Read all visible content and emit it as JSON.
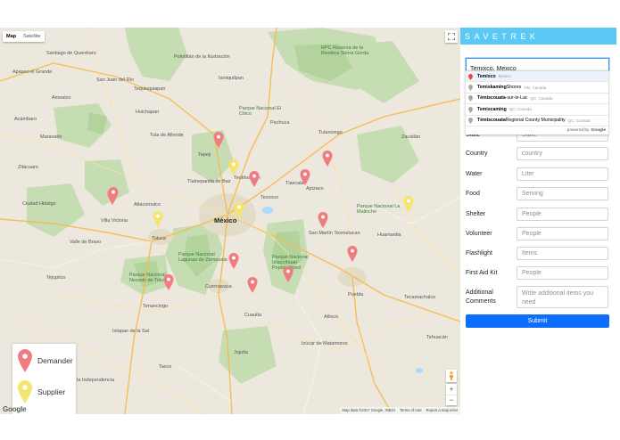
{
  "app": {
    "title": "SAVETREK"
  },
  "map": {
    "type_buttons": [
      {
        "label": "Map",
        "active": true
      },
      {
        "label": "Satellite",
        "active": false
      }
    ],
    "labels": [
      {
        "text": "Santiago de Querétaro",
        "cls": ""
      },
      {
        "text": "Apaseo el Grande",
        "cls": ""
      },
      {
        "text": "San Juan del Río",
        "cls": ""
      },
      {
        "text": "Tequisquiapan",
        "cls": ""
      },
      {
        "text": "Amealco",
        "cls": ""
      },
      {
        "text": "Polotitlán de la Ilustración",
        "cls": ""
      },
      {
        "text": "Huichapan",
        "cls": ""
      },
      {
        "text": "Ixmiquilpan",
        "cls": ""
      },
      {
        "text": "Tula de Allende",
        "cls": ""
      },
      {
        "text": "Pachuca",
        "cls": ""
      },
      {
        "text": "Tulancingo",
        "cls": ""
      },
      {
        "text": "Zacatlán",
        "cls": ""
      },
      {
        "text": "Tepeji",
        "cls": ""
      },
      {
        "text": "Tlalnepantla de Baz",
        "cls": ""
      },
      {
        "text": "Teotihuacán",
        "cls": ""
      },
      {
        "text": "Texcoco",
        "cls": ""
      },
      {
        "text": "México",
        "cls": "city"
      },
      {
        "text": "Atlacomulco",
        "cls": ""
      },
      {
        "text": "Villa Victoria",
        "cls": ""
      },
      {
        "text": "Toluca",
        "cls": ""
      },
      {
        "text": "Cuernavaca",
        "cls": ""
      },
      {
        "text": "Cuautla",
        "cls": ""
      },
      {
        "text": "Puebla",
        "cls": ""
      },
      {
        "text": "Tlaxcala",
        "cls": ""
      },
      {
        "text": "Apizaco",
        "cls": ""
      },
      {
        "text": "Huamantla",
        "cls": ""
      },
      {
        "text": "San Martín Texmelucan",
        "cls": ""
      },
      {
        "text": "Atlixco",
        "cls": ""
      },
      {
        "text": "Tecamachalco",
        "cls": ""
      },
      {
        "text": "Valle de Bravo",
        "cls": ""
      },
      {
        "text": "Tenancingo",
        "cls": ""
      },
      {
        "text": "Ixtapan de la Sal",
        "cls": ""
      },
      {
        "text": "Iguala de la Independencia",
        "cls": ""
      },
      {
        "text": "Taxco",
        "cls": ""
      },
      {
        "text": "Jojutla",
        "cls": ""
      },
      {
        "text": "Izúcar de Matamoros",
        "cls": ""
      },
      {
        "text": "Tehuacán",
        "cls": ""
      },
      {
        "text": "Zitácuaro",
        "cls": ""
      },
      {
        "text": "Tejupilco",
        "cls": ""
      },
      {
        "text": "Acámbaro",
        "cls": ""
      },
      {
        "text": "Maravatío",
        "cls": ""
      },
      {
        "text": "Ciudad Hidalgo",
        "cls": ""
      },
      {
        "text": "Parque Nacional Iztaccíhuatl-Popocatépetl",
        "cls": "green"
      },
      {
        "text": "Parque Nacional Lagunas de Zempoala",
        "cls": "green"
      },
      {
        "text": "Parque Nacional Nevado de Toluca",
        "cls": "green"
      },
      {
        "text": "RPC Reserva de la Biosfera Sierra Gorda",
        "cls": "green"
      },
      {
        "text": "Parque Nacional El Chico",
        "cls": "green"
      },
      {
        "text": "Parque Nacional La Malinche",
        "cls": "green"
      }
    ],
    "markers": [
      {
        "kind": "demander",
        "color": "#f07c82"
      },
      {
        "kind": "demander",
        "color": "#f07c82"
      },
      {
        "kind": "demander",
        "color": "#f07c82"
      },
      {
        "kind": "demander",
        "color": "#f07c82"
      },
      {
        "kind": "demander",
        "color": "#f07c82"
      },
      {
        "kind": "demander",
        "color": "#f07c82"
      },
      {
        "kind": "demander",
        "color": "#f07c82"
      },
      {
        "kind": "demander",
        "color": "#f07c82"
      },
      {
        "kind": "demander",
        "color": "#f07c82"
      },
      {
        "kind": "demander",
        "color": "#f07c82"
      },
      {
        "kind": "demander",
        "color": "#f07c82"
      },
      {
        "kind": "demander",
        "color": "#f07c82"
      },
      {
        "kind": "supplier",
        "color": "#f5e46e"
      },
      {
        "kind": "supplier",
        "color": "#f5e46e"
      },
      {
        "kind": "supplier",
        "color": "#f5e46e"
      },
      {
        "kind": "supplier",
        "color": "#f5e46e"
      }
    ],
    "legend": {
      "demander": {
        "label": "Demander",
        "color": "#f07c82"
      },
      "supplier": {
        "label": "Supplier",
        "color": "#f5e46e"
      }
    },
    "google_logo": "Google",
    "attribution": [
      "Map data ©2017 Google, INEGI",
      "Terms of Use",
      "Report a map error"
    ],
    "zoom_in": "+",
    "zoom_out": "−"
  },
  "search": {
    "value": "Temixco, Mexico",
    "suggestions": [
      {
        "main": "Temixco",
        "rest": "",
        "secondary": "Mexico"
      },
      {
        "main": "Temiskaming",
        "rest": " Shores",
        "secondary": "ON, Canada"
      },
      {
        "main": "Témiscouata",
        "rest": "-sur-le-Lac",
        "secondary": "QC, Canada"
      },
      {
        "main": "Temiscaming",
        "rest": "",
        "secondary": "QC, Canada"
      },
      {
        "main": "Témiscouata",
        "rest": " Regional County Municipality",
        "secondary": "QC, Canada"
      }
    ],
    "powered_by": "powered by",
    "powered_brand": "Google"
  },
  "form": {
    "state": {
      "label": "State",
      "placeholder": "State"
    },
    "country": {
      "label": "Country",
      "placeholder": "country"
    },
    "water": {
      "label": "Water",
      "placeholder": "Liter"
    },
    "food": {
      "label": "Food",
      "placeholder": "Serving"
    },
    "shelter": {
      "label": "Shelter",
      "placeholder": "People"
    },
    "volunteer": {
      "label": "Volunteer",
      "placeholder": "People"
    },
    "flashlight": {
      "label": "Flashlight",
      "placeholder": "Items"
    },
    "first_aid": {
      "label": "First Aid Kit",
      "placeholder": "People"
    },
    "comments": {
      "label": "Additional Comments",
      "placeholder": "Write additional items you need"
    },
    "submit": "Submit"
  },
  "colors": {
    "header": "#5bc8f5",
    "submit": "#0d6efd"
  }
}
